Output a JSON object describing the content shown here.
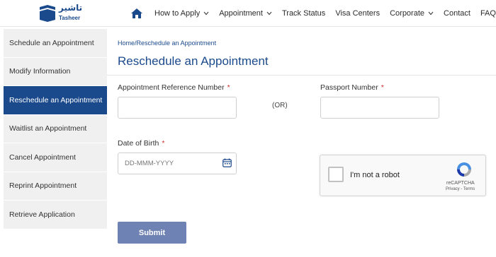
{
  "header": {
    "logo_arabic": "تاشير",
    "logo_text": "Tasheer",
    "nav": [
      {
        "label": "How to Apply",
        "dropdown": true
      },
      {
        "label": "Appointment",
        "dropdown": true
      },
      {
        "label": "Track Status",
        "dropdown": false
      },
      {
        "label": "Visa Centers",
        "dropdown": false
      },
      {
        "label": "Corporate",
        "dropdown": true
      },
      {
        "label": "Contact",
        "dropdown": false
      },
      {
        "label": "FAQ",
        "dropdown": false
      }
    ]
  },
  "sidebar": {
    "items": [
      {
        "label": "Schedule an Appointment"
      },
      {
        "label": "Modify Information"
      },
      {
        "label": "Reschedule an Appointment",
        "active": true
      },
      {
        "label": "Waitlist an Appointment"
      },
      {
        "label": "Cancel Appointment"
      },
      {
        "label": "Reprint Appointment"
      },
      {
        "label": "Retrieve Application"
      }
    ]
  },
  "main": {
    "breadcrumb": "Home/Reschedule an Appointment",
    "title": "Reschedule an Appointment",
    "form": {
      "reference_label": "Appointment Reference Number",
      "or_text": "(OR)",
      "passport_label": "Passport Number",
      "dob_label": "Date of Birth",
      "dob_placeholder": "DD-MMM-YYYY",
      "required_mark": "*",
      "submit_label": "Submit"
    },
    "recaptcha": {
      "label": "I'm not a robot",
      "brand": "reCAPTCHA",
      "links": "Privacy - Terms"
    }
  },
  "colors": {
    "brand_blue": "#1b4a8c",
    "submit_bg": "#6f82b4",
    "required_red": "#d32f2f"
  }
}
